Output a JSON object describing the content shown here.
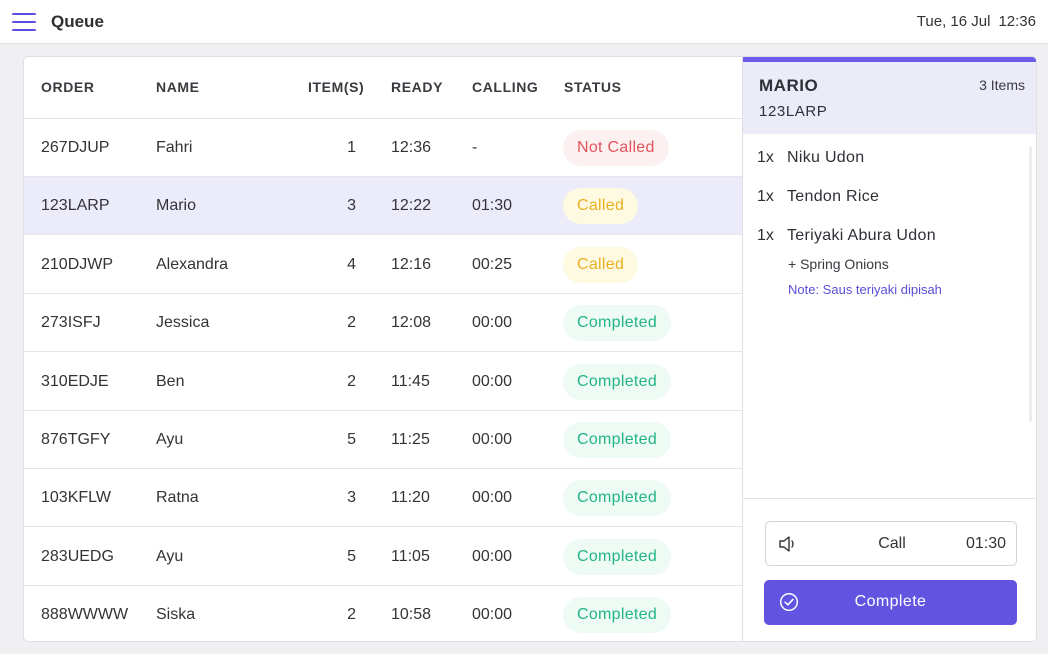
{
  "header": {
    "title": "Queue",
    "date": "Tue, 16 Jul",
    "time": "12:36",
    "menu_icon": "hamburger-menu-icon"
  },
  "table": {
    "columns": [
      "ORDER",
      "NAME",
      "ITEM(S)",
      "READY",
      "CALLING",
      "STATUS"
    ],
    "rows": [
      {
        "order": "267DJUP",
        "name": "Fahri",
        "items": "1",
        "ready": "12:36",
        "calling": "-",
        "status": "Not Called",
        "status_type": "not-called"
      },
      {
        "order": "123LARP",
        "name": "Mario",
        "items": "3",
        "ready": "12:22",
        "calling": "01:30",
        "status": "Called",
        "status_type": "called",
        "selected": true
      },
      {
        "order": "210DJWP",
        "name": "Alexandra",
        "items": "4",
        "ready": "12:16",
        "calling": "00:25",
        "status": "Called",
        "status_type": "called"
      },
      {
        "order": "273ISFJ",
        "name": "Jessica",
        "items": "2",
        "ready": "12:08",
        "calling": "00:00",
        "status": "Completed",
        "status_type": "completed"
      },
      {
        "order": "310EDJE",
        "name": "Ben",
        "items": "2",
        "ready": "11:45",
        "calling": "00:00",
        "status": "Completed",
        "status_type": "completed"
      },
      {
        "order": "876TGFY",
        "name": "Ayu",
        "items": "5",
        "ready": "11:25",
        "calling": "00:00",
        "status": "Completed",
        "status_type": "completed"
      },
      {
        "order": "103KFLW",
        "name": "Ratna",
        "items": "3",
        "ready": "11:20",
        "calling": "00:00",
        "status": "Completed",
        "status_type": "completed"
      },
      {
        "order": "283UEDG",
        "name": "Ayu",
        "items": "5",
        "ready": "11:05",
        "calling": "00:00",
        "status": "Completed",
        "status_type": "completed"
      },
      {
        "order": "888WWWW",
        "name": "Siska",
        "items": "2",
        "ready": "10:58",
        "calling": "00:00",
        "status": "Completed",
        "status_type": "completed"
      }
    ]
  },
  "detail": {
    "customer_name": "MARIO",
    "order_code": "123LARP",
    "items_count": "3 Items",
    "items": [
      {
        "qty": "1x",
        "name": "Niku Udon"
      },
      {
        "qty": "1x",
        "name": "Tendon Rice"
      },
      {
        "qty": "1x",
        "name": "Teriyaki Abura Udon",
        "modifier": "+ Spring Onions",
        "note": "Note: Saus teriyaki dipisah"
      }
    ],
    "call_button": {
      "label": "Call",
      "timer": "01:30",
      "icon": "speaker-icon"
    },
    "complete_button": {
      "label": "Complete",
      "icon": "check-circle-icon"
    }
  },
  "colors": {
    "accent": "#6353e1",
    "selected_row": "#ebebfa",
    "not_called": "#e0545c",
    "called": "#e9b020",
    "completed": "#22b583"
  }
}
